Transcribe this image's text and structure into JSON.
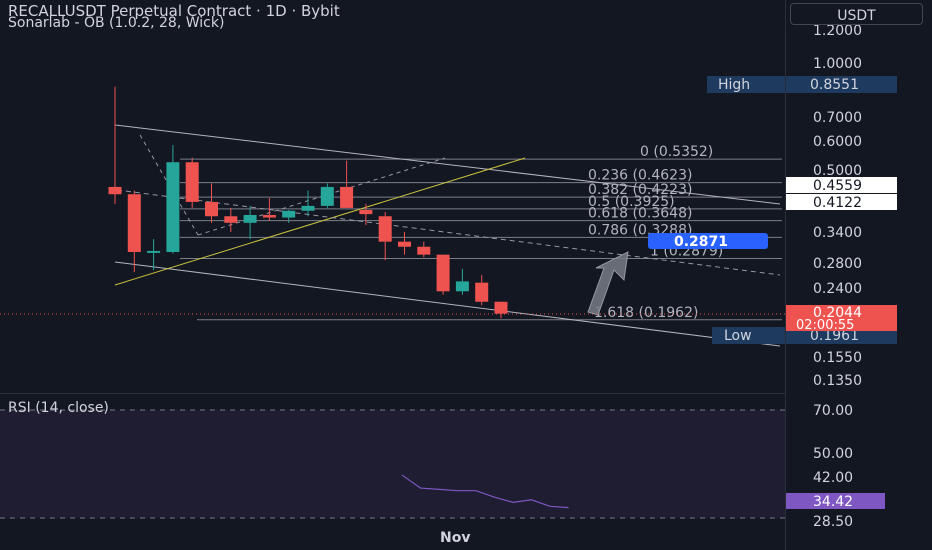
{
  "header": {
    "title": "RECALLUSDT Perpetual Contract · 1D · Bybit",
    "indicator": "Sonarlab - OB (1.0.2, 28, Wick)",
    "currency_button": "USDT"
  },
  "price_axis": {
    "ticks": [
      "1.2000",
      "1.0000",
      "0.7000",
      "0.6000",
      "0.5000",
      "0.3400",
      "0.2800",
      "0.2400",
      "0.1550",
      "0.1350"
    ],
    "high_label": "High",
    "high_value": "0.8551",
    "low_label": "Low",
    "low_value": "0.1961",
    "price_tag_1": "0.4559",
    "price_tag_2": "0.4122",
    "current_price": "0.2044",
    "countdown": "02:00:55"
  },
  "fibonacci": [
    {
      "label": "0 (0.5352)"
    },
    {
      "label": "0.236 (0.4623)"
    },
    {
      "label": "0.382 (0.4223)"
    },
    {
      "label": "0.5 (0.3925)"
    },
    {
      "label": "0.618 (0.3648)"
    },
    {
      "label": "0.786 (0.3288)"
    },
    {
      "label": "1 (0.2879)"
    },
    {
      "label": "1.618 (0.1962)"
    }
  ],
  "target_label": "0.2871",
  "rsi": {
    "label": "RSI (14, close)",
    "ticks": [
      "70.00",
      "50.00",
      "42.00",
      "28.50"
    ],
    "current": "34.42",
    "values": [
      45,
      40,
      39.5,
      39,
      39,
      36.5,
      34.5,
      35.5,
      33,
      32.5
    ]
  },
  "time_axis": {
    "label": "Nov"
  },
  "colors": {
    "background": "#131722",
    "up": "#26a69a",
    "down": "#ef5350",
    "rsi": "#7e57c2",
    "high_low_tag": "#1e3a5f",
    "target": "#2962ff",
    "trendline": "#c9c23e"
  },
  "candles": [
    {
      "o": 0.45,
      "h": 0.855,
      "l": 0.405,
      "c": 0.43
    },
    {
      "o": 0.43,
      "h": 0.44,
      "l": 0.265,
      "c": 0.3
    },
    {
      "o": 0.3,
      "h": 0.325,
      "l": 0.268,
      "c": 0.302
    },
    {
      "o": 0.3,
      "h": 0.585,
      "l": 0.297,
      "c": 0.525
    },
    {
      "o": 0.525,
      "h": 0.54,
      "l": 0.395,
      "c": 0.41
    },
    {
      "o": 0.41,
      "h": 0.46,
      "l": 0.36,
      "c": 0.375
    },
    {
      "o": 0.375,
      "h": 0.395,
      "l": 0.34,
      "c": 0.36
    },
    {
      "o": 0.36,
      "h": 0.4,
      "l": 0.325,
      "c": 0.378
    },
    {
      "o": 0.378,
      "h": 0.42,
      "l": 0.365,
      "c": 0.372
    },
    {
      "o": 0.372,
      "h": 0.39,
      "l": 0.36,
      "c": 0.388
    },
    {
      "o": 0.388,
      "h": 0.44,
      "l": 0.375,
      "c": 0.4
    },
    {
      "o": 0.4,
      "h": 0.46,
      "l": 0.395,
      "c": 0.45
    },
    {
      "o": 0.45,
      "h": 0.53,
      "l": 0.4,
      "c": 0.395
    },
    {
      "o": 0.39,
      "h": 0.405,
      "l": 0.355,
      "c": 0.38
    },
    {
      "o": 0.375,
      "h": 0.385,
      "l": 0.285,
      "c": 0.32
    },
    {
      "o": 0.32,
      "h": 0.34,
      "l": 0.295,
      "c": 0.31
    },
    {
      "o": 0.31,
      "h": 0.32,
      "l": 0.29,
      "c": 0.295
    },
    {
      "o": 0.295,
      "h": 0.28,
      "l": 0.23,
      "c": 0.235
    },
    {
      "o": 0.235,
      "h": 0.27,
      "l": 0.23,
      "c": 0.25
    },
    {
      "o": 0.248,
      "h": 0.26,
      "l": 0.215,
      "c": 0.22
    },
    {
      "o": 0.22,
      "h": 0.215,
      "l": 0.198,
      "c": 0.204
    }
  ]
}
